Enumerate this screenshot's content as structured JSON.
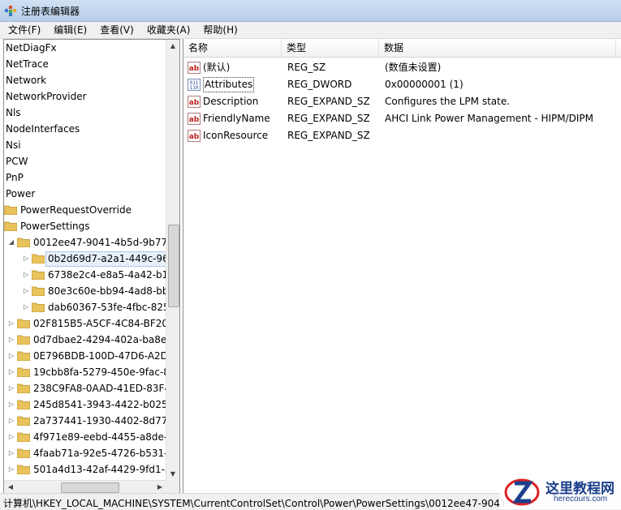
{
  "window": {
    "title": "注册表编辑器"
  },
  "menu": [
    "文件(F)",
    "编辑(E)",
    "查看(V)",
    "收藏夹(A)",
    "帮助(H)"
  ],
  "tree": {
    "items": [
      {
        "label": "NetDiagFx"
      },
      {
        "label": "NetTrace"
      },
      {
        "label": "Network"
      },
      {
        "label": "NetworkProvider"
      },
      {
        "label": "Nls"
      },
      {
        "label": "NodeInterfaces"
      },
      {
        "label": "Nsi"
      },
      {
        "label": "PCW"
      },
      {
        "label": "PnP"
      },
      {
        "label": "Power"
      },
      {
        "label": "PowerRequestOverride"
      },
      {
        "label": "PowerSettings"
      },
      {
        "label": "0012ee47-9041-4b5d-9b77"
      },
      {
        "label": "0b2d69d7-a2a1-449c-96"
      },
      {
        "label": "6738e2c4-e8a5-4a42-b1"
      },
      {
        "label": "80e3c60e-bb94-4ad8-bb"
      },
      {
        "label": "dab60367-53fe-4fbc-825"
      },
      {
        "label": "02F815B5-A5CF-4C84-BF20-"
      },
      {
        "label": "0d7dbae2-4294-402a-ba8e"
      },
      {
        "label": "0E796BDB-100D-47D6-A2D"
      },
      {
        "label": "19cbb8fa-5279-450e-9fac-8"
      },
      {
        "label": "238C9FA8-0AAD-41ED-83F4"
      },
      {
        "label": "245d8541-3943-4422-b025-"
      },
      {
        "label": "2a737441-1930-4402-8d77-"
      },
      {
        "label": "4f971e89-eebd-4455-a8de-"
      },
      {
        "label": "4faab71a-92e5-4726-b531-"
      },
      {
        "label": "501a4d13-42af-4429-9fd1-a"
      }
    ]
  },
  "values": {
    "headers": {
      "name": "名称",
      "type": "类型",
      "data": "数据"
    },
    "rows": [
      {
        "name": "(默认)",
        "type": "REG_SZ",
        "data": "(数值未设置)",
        "icon": "string-value-icon"
      },
      {
        "name": "Attributes",
        "type": "REG_DWORD",
        "data": "0x00000001 (1)",
        "icon": "dword-value-icon"
      },
      {
        "name": "Description",
        "type": "REG_EXPAND_SZ",
        "data": "Configures the LPM state.",
        "icon": "string-value-icon"
      },
      {
        "name": "FriendlyName",
        "type": "REG_EXPAND_SZ",
        "data": "AHCI Link Power Management - HIPM/DIPM",
        "icon": "string-value-icon"
      },
      {
        "name": "IconResource",
        "type": "REG_EXPAND_SZ",
        "data": "",
        "icon": "string-value-icon"
      }
    ]
  },
  "status": {
    "path": "计算机\\HKEY_LOCAL_MACHINE\\SYSTEM\\CurrentControlSet\\Control\\Power\\PowerSettings\\0012ee47-9041-"
  },
  "watermark": {
    "title": "这里教程网",
    "url": "herecours.com"
  },
  "colors": {
    "folder": "#e8c25a",
    "title_bg": "#c6d9f0",
    "selection": "#e8f0fb",
    "watermark": "#1c3f8c"
  }
}
